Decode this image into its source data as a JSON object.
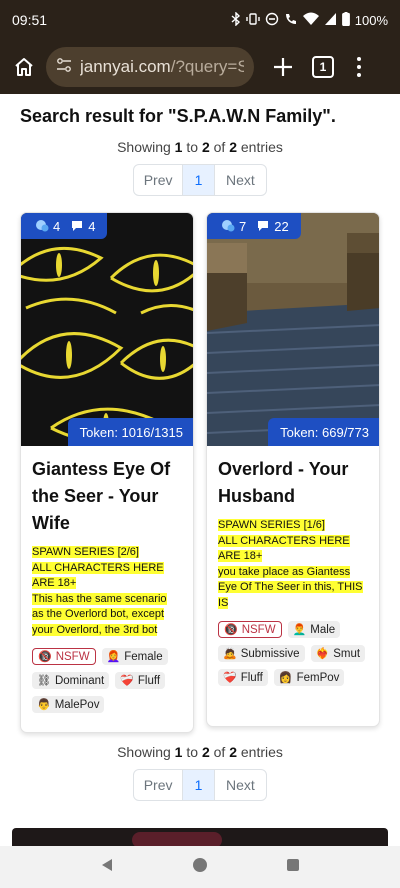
{
  "status_bar": {
    "time": "09:51",
    "battery": "100%"
  },
  "browser": {
    "url_host": "jannyai.com",
    "url_path": "/?query=S.I",
    "tab_count": "1"
  },
  "search": {
    "heading": "Search result for \"S.P.A.W.N Family\".",
    "showing_prefix": "Showing",
    "showing_from": "1",
    "showing_to_word": "to",
    "showing_to": "2",
    "showing_of_word": "of",
    "showing_total": "2",
    "showing_suffix": "entries"
  },
  "pagination": {
    "prev": "Prev",
    "page": "1",
    "next": "Next"
  },
  "cards": [
    {
      "likes": "4",
      "comments": "4",
      "token": "Token: 1016/1315",
      "title": "Giantess Eye Of the Seer - Your Wife",
      "desc_lines": [
        "SPAWN SERIES [2/6]",
        "ALL CHARACTERS HERE",
        "ARE 18+",
        "This has the same scenario",
        "as the Overlord bot, except",
        "your Overlord, the 3rd bot"
      ],
      "tags": [
        {
          "icon": "🔞",
          "label": "NSFW"
        },
        {
          "icon": "👩‍🦰",
          "label": "Female"
        },
        {
          "icon": "⛓",
          "label": "Dominant"
        },
        {
          "icon": "❤️‍🩹",
          "label": "Fluff"
        },
        {
          "icon": "👨",
          "label": "MalePov"
        }
      ]
    },
    {
      "likes": "7",
      "comments": "22",
      "token": "Token: 669/773",
      "title": "Overlord - Your Husband",
      "desc_lines": [
        "SPAWN SERIES [1/6]",
        "ALL CHARACTERS HERE",
        "ARE 18+",
        "you take place as Giantess",
        "Eye Of The Seer in this, THIS",
        "IS"
      ],
      "tags": [
        {
          "icon": "🔞",
          "label": "NSFW"
        },
        {
          "icon": "👨‍🦰",
          "label": "Male"
        },
        {
          "icon": "🙇",
          "label": "Submissive"
        },
        {
          "icon": "❤️‍🔥",
          "label": "Smut"
        },
        {
          "icon": "❤️‍🩹",
          "label": "Fluff"
        },
        {
          "icon": "👩",
          "label": "FemPov"
        }
      ]
    }
  ],
  "colors": {
    "accent_blue": "#1e4fc2",
    "highlight": "#ffff33",
    "browser_bg": "#2b2219"
  }
}
